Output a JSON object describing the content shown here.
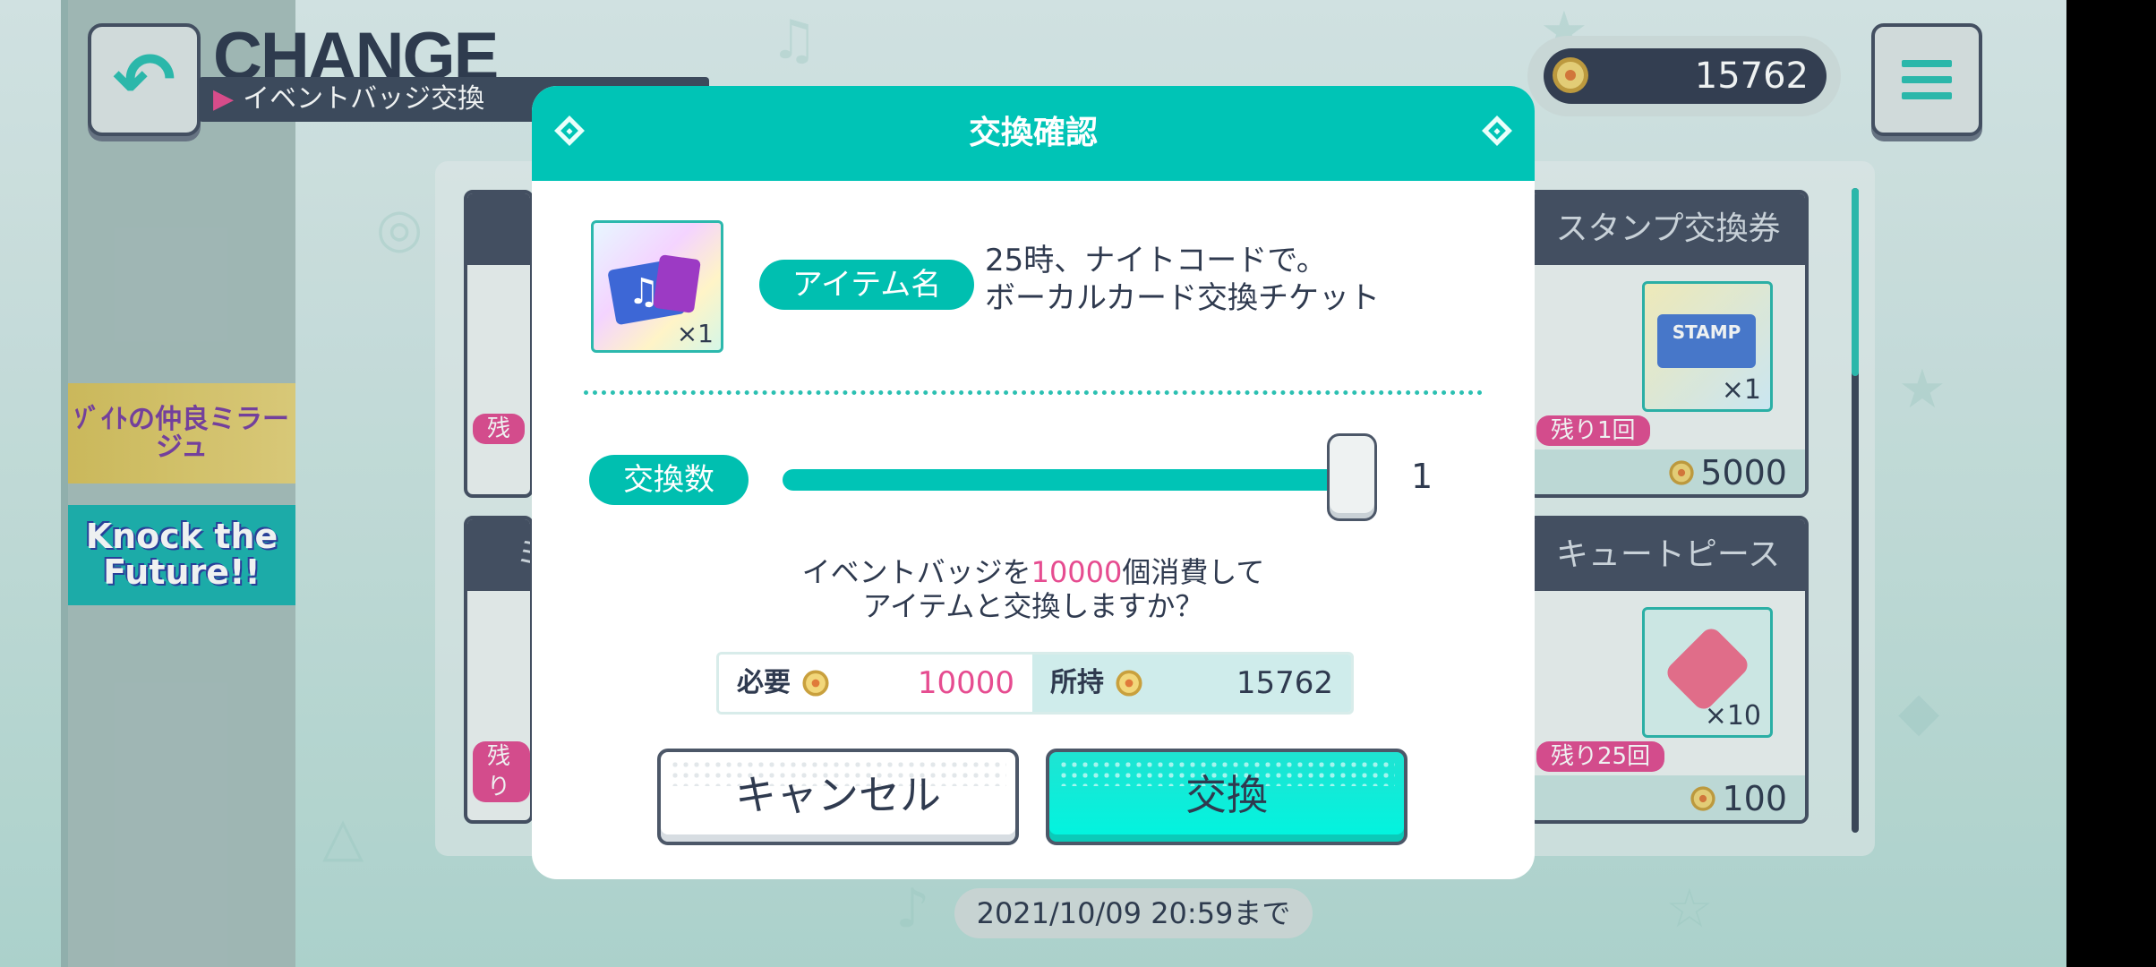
{
  "header": {
    "title": "CHANGE",
    "subtitle": "イベントバッジ交換"
  },
  "currency": {
    "amount": "15762"
  },
  "shop": {
    "cards": [
      {
        "title": "スタンプ交換券",
        "remaining": "残り1回",
        "price": "5000",
        "thumb_count": "×1",
        "thumb_label": "STAMP"
      },
      {
        "title": "キュートピース",
        "remaining": "残り25回",
        "price": "100",
        "thumb_count": "×10"
      }
    ],
    "left_partial": [
      "残",
      "ミ",
      "残り"
    ],
    "deadline": "2021/10/09 20:59まで"
  },
  "banners": {
    "banner1": "ｿﾞｲﾄの仲良ミラージュ",
    "banner2": "Knock the Future!!"
  },
  "dialog": {
    "title": "交換確認",
    "item_label": "アイテム名",
    "item_name_line1": "25時、ナイトコードで。",
    "item_name_line2": "ボーカルカード交換チケット",
    "item_count": "×1",
    "quantity_label": "交換数",
    "quantity": "1",
    "quantity_fraction": 1.0,
    "confirm_part1": "イベントバッジを",
    "confirm_amount": "10000",
    "confirm_part2": "個消費して",
    "confirm_line2": "アイテムと交換しますか？",
    "need_label": "必要",
    "need_value": "10000",
    "have_label": "所持",
    "have_value": "15762",
    "cancel_label": "キャンセル",
    "exchange_label": "交換"
  },
  "colors": {
    "accent": "#00c4b6",
    "pink": "#e64c90",
    "navy": "#465063"
  }
}
